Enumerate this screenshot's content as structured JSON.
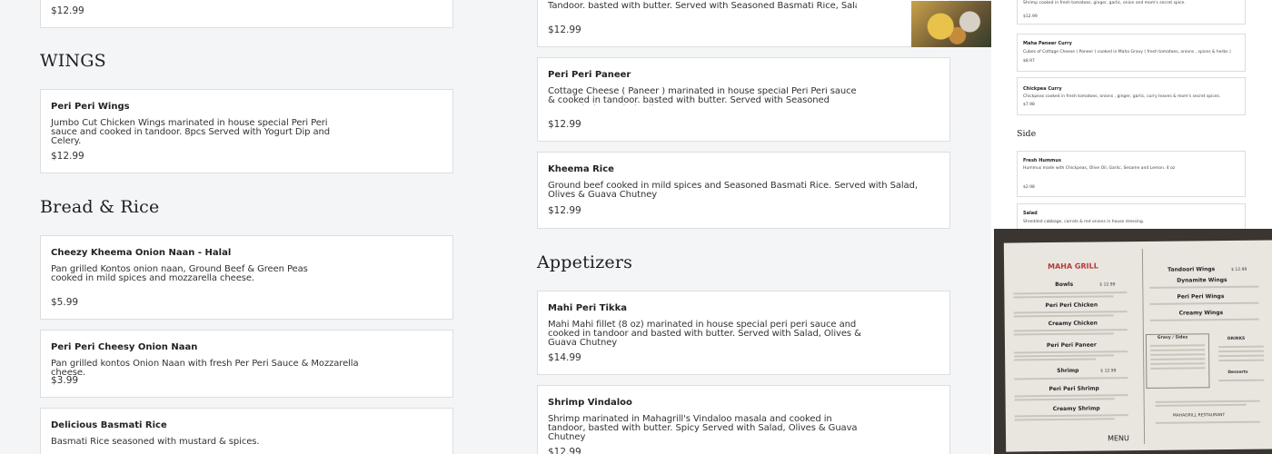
{
  "left": {
    "top_price": "$12.99",
    "wings_title": "WINGS",
    "wings": [
      {
        "name": "Peri Peri Wings",
        "desc": "Jumbo Cut Chicken Wings marinated in house special Peri Peri sauce and cooked in tandoor. 8pcs Served with Yogurt Dip and Celery.",
        "price": "$12.99"
      }
    ],
    "bread_title": "Bread & Rice",
    "bread": [
      {
        "name": "Cheezy Kheema Onion Naan - Halal",
        "desc": "Pan grilled Kontos onion naan, Ground Beef & Green Peas cooked in mild spices and mozzarella cheese.",
        "price": "$5.99"
      },
      {
        "name": "Peri Peri Cheesy Onion Naan",
        "desc": "Pan grilled kontos Onion Naan with fresh Per Peri Sauce & Mozzarella cheese.",
        "price": "$3.99"
      },
      {
        "name": "Delicious Basmati Rice",
        "desc": "Basmati Rice seasoned with mustard & spices."
      }
    ]
  },
  "middle": {
    "top_desc": "Tandoor. basted with butter. Served with Seasoned Basmati Rice, Salad, Olives ...",
    "top_price": "$12.99",
    "items": [
      {
        "name": "Peri Peri Paneer",
        "desc": "Cottage Cheese ( Paneer ) marinated in house special Peri Peri sauce & cooked in tandoor. basted with butter. Served with Seasoned Basmati Rice, Salad, Olive...",
        "price": "$12.99"
      },
      {
        "name": "Kheema Rice",
        "desc": "Ground beef cooked in mild spices and Seasoned Basmati Rice. Served with Salad, Olives & Guava Chutney",
        "price": "$12.99"
      }
    ],
    "appetizers_title": "Appetizers",
    "appetizers": [
      {
        "name": "Mahi Peri Tikka",
        "desc": "Mahi Mahi fillet (8 oz) marinated in house special peri peri sauce and cooked in tandoor and basted with butter. Served with Salad, Olives & Guava Chutney",
        "price": "$14.99"
      },
      {
        "name": "Shrimp Vindaloo",
        "desc": "Shrimp marinated in Mahagrill's Vindaloo masala and cooked in tandoor, basted with butter. Spicy Served with Salad, Olives & Guava Chutney",
        "price": "$12.99"
      }
    ]
  },
  "right": {
    "top_desc": "Shrimp cooked in fresh tomatoes, ginger, garlic, onion and mom's secret spice.",
    "top_price": "$12.99",
    "items": [
      {
        "name": "Maha Paneer Curry",
        "desc": "Cubes of Cottage Cheese ( Paneer ) cooked in Maha Gravy ( fresh tomatoes, onions , spices & herbs )",
        "price": "$8.97"
      },
      {
        "name": "Chickpea Curry",
        "desc": "Chickpeas cooked in fresh tomatoes, onions , ginger, garlic, curry leaves & mom's secret spices.",
        "price": "$7.98"
      }
    ],
    "side_title": "Side",
    "sides": [
      {
        "name": "Fresh Hummus",
        "desc": "Hummus made with Chickpeas, Olive Oil, Garlic, Sesame and Lemon. 4 oz",
        "price": "$2.98"
      },
      {
        "name": "Salad",
        "desc": "Shredded cabbage, carrots & red onions in house dressing."
      }
    ]
  },
  "menu_photo": {
    "brand": "MAHA GRILL",
    "left_headings": [
      "Bowls",
      "Peri Peri Chicken",
      "Creamy Chicken",
      "Peri Peri Paneer",
      "Shrimp",
      "Peri Peri Shrimp",
      "Creamy Shrimp"
    ],
    "bowls_price": "$ 12.99",
    "shrimp_price": "$ 12.99",
    "right_headings": [
      "Tandoori Wings",
      "Dynamite Wings",
      "Peri Peri Wings",
      "Creamy Wings"
    ],
    "wings_price": "$ 12.99",
    "gravy_heading": "Gravy / Sides",
    "drinks_heading": "DRINKS",
    "desserts_heading": "Desserts",
    "restaurant": "MAHAGRILL RESTAURANT",
    "footer": "MENU"
  },
  "colors": {
    "page_bg": "#f4f5f7",
    "card_border": "#dedede",
    "text": "#222222"
  }
}
